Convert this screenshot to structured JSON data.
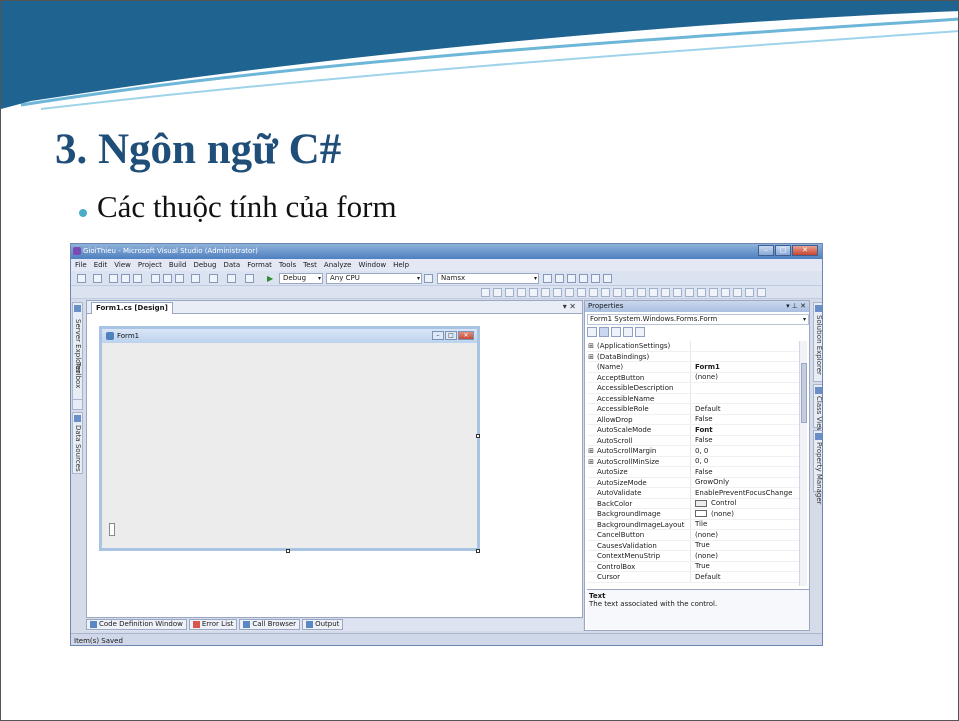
{
  "slide": {
    "title": "3. Ngôn ngữ C#",
    "bullet": "Các thuộc tính của form"
  },
  "vs": {
    "window_title": "GioiThieu - Microsoft Visual Studio (Administrator)",
    "window_buttons": {
      "minimize": "–",
      "maximize": "□",
      "close": "✕"
    },
    "menu": [
      "File",
      "Edit",
      "View",
      "Project",
      "Build",
      "Debug",
      "Data",
      "Format",
      "Tools",
      "Test",
      "Analyze",
      "Window",
      "Help"
    ],
    "toolbar": {
      "config": "Debug",
      "platform": "Any CPU",
      "find": "Namsx"
    },
    "left_tabs": [
      "Server Explorer",
      "Toolbox",
      "Data Sources"
    ],
    "right_tabs": [
      "Solution Explorer",
      "Class View",
      "Property Manager"
    ],
    "document_tab": "Form1.cs [Design]",
    "document_controls": "▾ ✕",
    "form": {
      "title": "Form1",
      "buttons": {
        "minimize": "–",
        "maximize": "□",
        "close": "✕"
      }
    },
    "bottom_tabs": [
      "Code Definition Window",
      "Error List",
      "Call Browser",
      "Output"
    ],
    "status": "Item(s) Saved"
  },
  "properties": {
    "header": "Properties",
    "header_controls": "▾ ⊥ ✕",
    "object": "Form1  System.Windows.Forms.Form",
    "rows": [
      {
        "expand": "⊞",
        "name": "(ApplicationSettings)",
        "value": ""
      },
      {
        "expand": "⊞",
        "name": "(DataBindings)",
        "value": ""
      },
      {
        "expand": "",
        "name": "(Name)",
        "value": "Form1",
        "bold": true
      },
      {
        "expand": "",
        "name": "AcceptButton",
        "value": "(none)"
      },
      {
        "expand": "",
        "name": "AccessibleDescription",
        "value": ""
      },
      {
        "expand": "",
        "name": "AccessibleName",
        "value": ""
      },
      {
        "expand": "",
        "name": "AccessibleRole",
        "value": "Default"
      },
      {
        "expand": "",
        "name": "AllowDrop",
        "value": "False"
      },
      {
        "expand": "",
        "name": "AutoScaleMode",
        "value": "Font",
        "bold": true
      },
      {
        "expand": "",
        "name": "AutoScroll",
        "value": "False"
      },
      {
        "expand": "⊞",
        "name": "AutoScrollMargin",
        "value": "0, 0"
      },
      {
        "expand": "⊞",
        "name": "AutoScrollMinSize",
        "value": "0, 0"
      },
      {
        "expand": "",
        "name": "AutoSize",
        "value": "False"
      },
      {
        "expand": "",
        "name": "AutoSizeMode",
        "value": "GrowOnly"
      },
      {
        "expand": "",
        "name": "AutoValidate",
        "value": "EnablePreventFocusChange"
      },
      {
        "expand": "",
        "name": "BackColor",
        "value": "Control",
        "swatch": "control"
      },
      {
        "expand": "",
        "name": "BackgroundImage",
        "value": "(none)",
        "swatch": "white"
      },
      {
        "expand": "",
        "name": "BackgroundImageLayout",
        "value": "Tile"
      },
      {
        "expand": "",
        "name": "CancelButton",
        "value": "(none)"
      },
      {
        "expand": "",
        "name": "CausesValidation",
        "value": "True"
      },
      {
        "expand": "",
        "name": "ContextMenuStrip",
        "value": "(none)"
      },
      {
        "expand": "",
        "name": "ControlBox",
        "value": "True"
      },
      {
        "expand": "",
        "name": "Cursor",
        "value": "Default"
      }
    ],
    "description_title": "Text",
    "description_text": "The text associated with the control."
  },
  "colors": {
    "title": "#1f4e79",
    "bullet": "#4bacc6",
    "band": "#1f6391"
  }
}
